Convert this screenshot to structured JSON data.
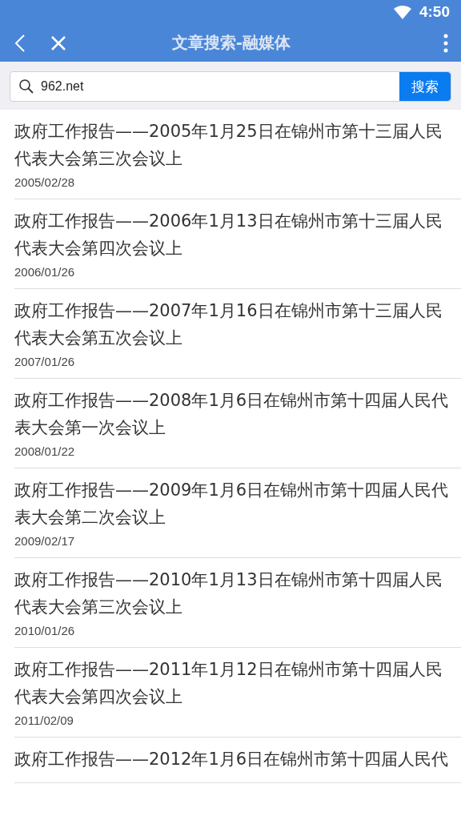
{
  "status_bar": {
    "time": "4:50"
  },
  "toolbar": {
    "title": "文章搜索-融媒体"
  },
  "search": {
    "value": "962.net",
    "button": "搜索"
  },
  "articles": [
    {
      "title": "政府工作报告——2005年1月25日在锦州市第十三届人民代表大会第三次会议上",
      "date": "2005/02/28"
    },
    {
      "title": "政府工作报告——2006年1月13日在锦州市第十三届人民代表大会第四次会议上",
      "date": "2006/01/26"
    },
    {
      "title": "政府工作报告——2007年1月16日在锦州市第十三届人民代表大会第五次会议上",
      "date": "2007/01/26"
    },
    {
      "title": "政府工作报告——2008年1月6日在锦州市第十四届人民代表大会第一次会议上",
      "date": "2008/01/22"
    },
    {
      "title": "政府工作报告——2009年1月6日在锦州市第十四届人民代表大会第二次会议上",
      "date": "2009/02/17"
    },
    {
      "title": "政府工作报告——2010年1月13日在锦州市第十四届人民代表大会第三次会议上",
      "date": "2010/01/26"
    },
    {
      "title": "政府工作报告——2011年1月12日在锦州市第十四届人民代表大会第四次会议上",
      "date": "2011/02/09"
    },
    {
      "title": "政府工作报告——2012年1月6日在锦州市第十四届人民代"
    }
  ]
}
